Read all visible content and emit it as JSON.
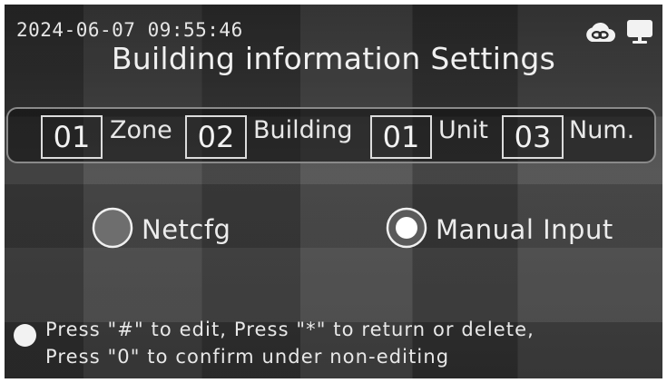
{
  "status_bar": {
    "datetime": "2024-06-07  09:55:46",
    "icons": [
      "cloud-link-icon",
      "monitor-icon"
    ]
  },
  "title": "Building information Settings",
  "address": {
    "zone_value": "01",
    "zone_label": "Zone",
    "building_value": "02",
    "building_label": "Building",
    "unit_value": "01",
    "unit_label": "Unit",
    "num_value": "03",
    "num_label": "Num."
  },
  "mode": {
    "options": [
      {
        "label": "Netcfg",
        "selected": false
      },
      {
        "label": "Manual Input",
        "selected": true
      }
    ]
  },
  "hint": {
    "line1": "Press \"#\" to edit, Press \"*\" to return or delete,",
    "line2": "Press \"0\" to confirm under non-editing"
  },
  "colors": {
    "background": "#3a3a3a",
    "text": "#ececec",
    "radio_unselected": "#6e6e6e",
    "radio_selected": "#ffffff"
  }
}
